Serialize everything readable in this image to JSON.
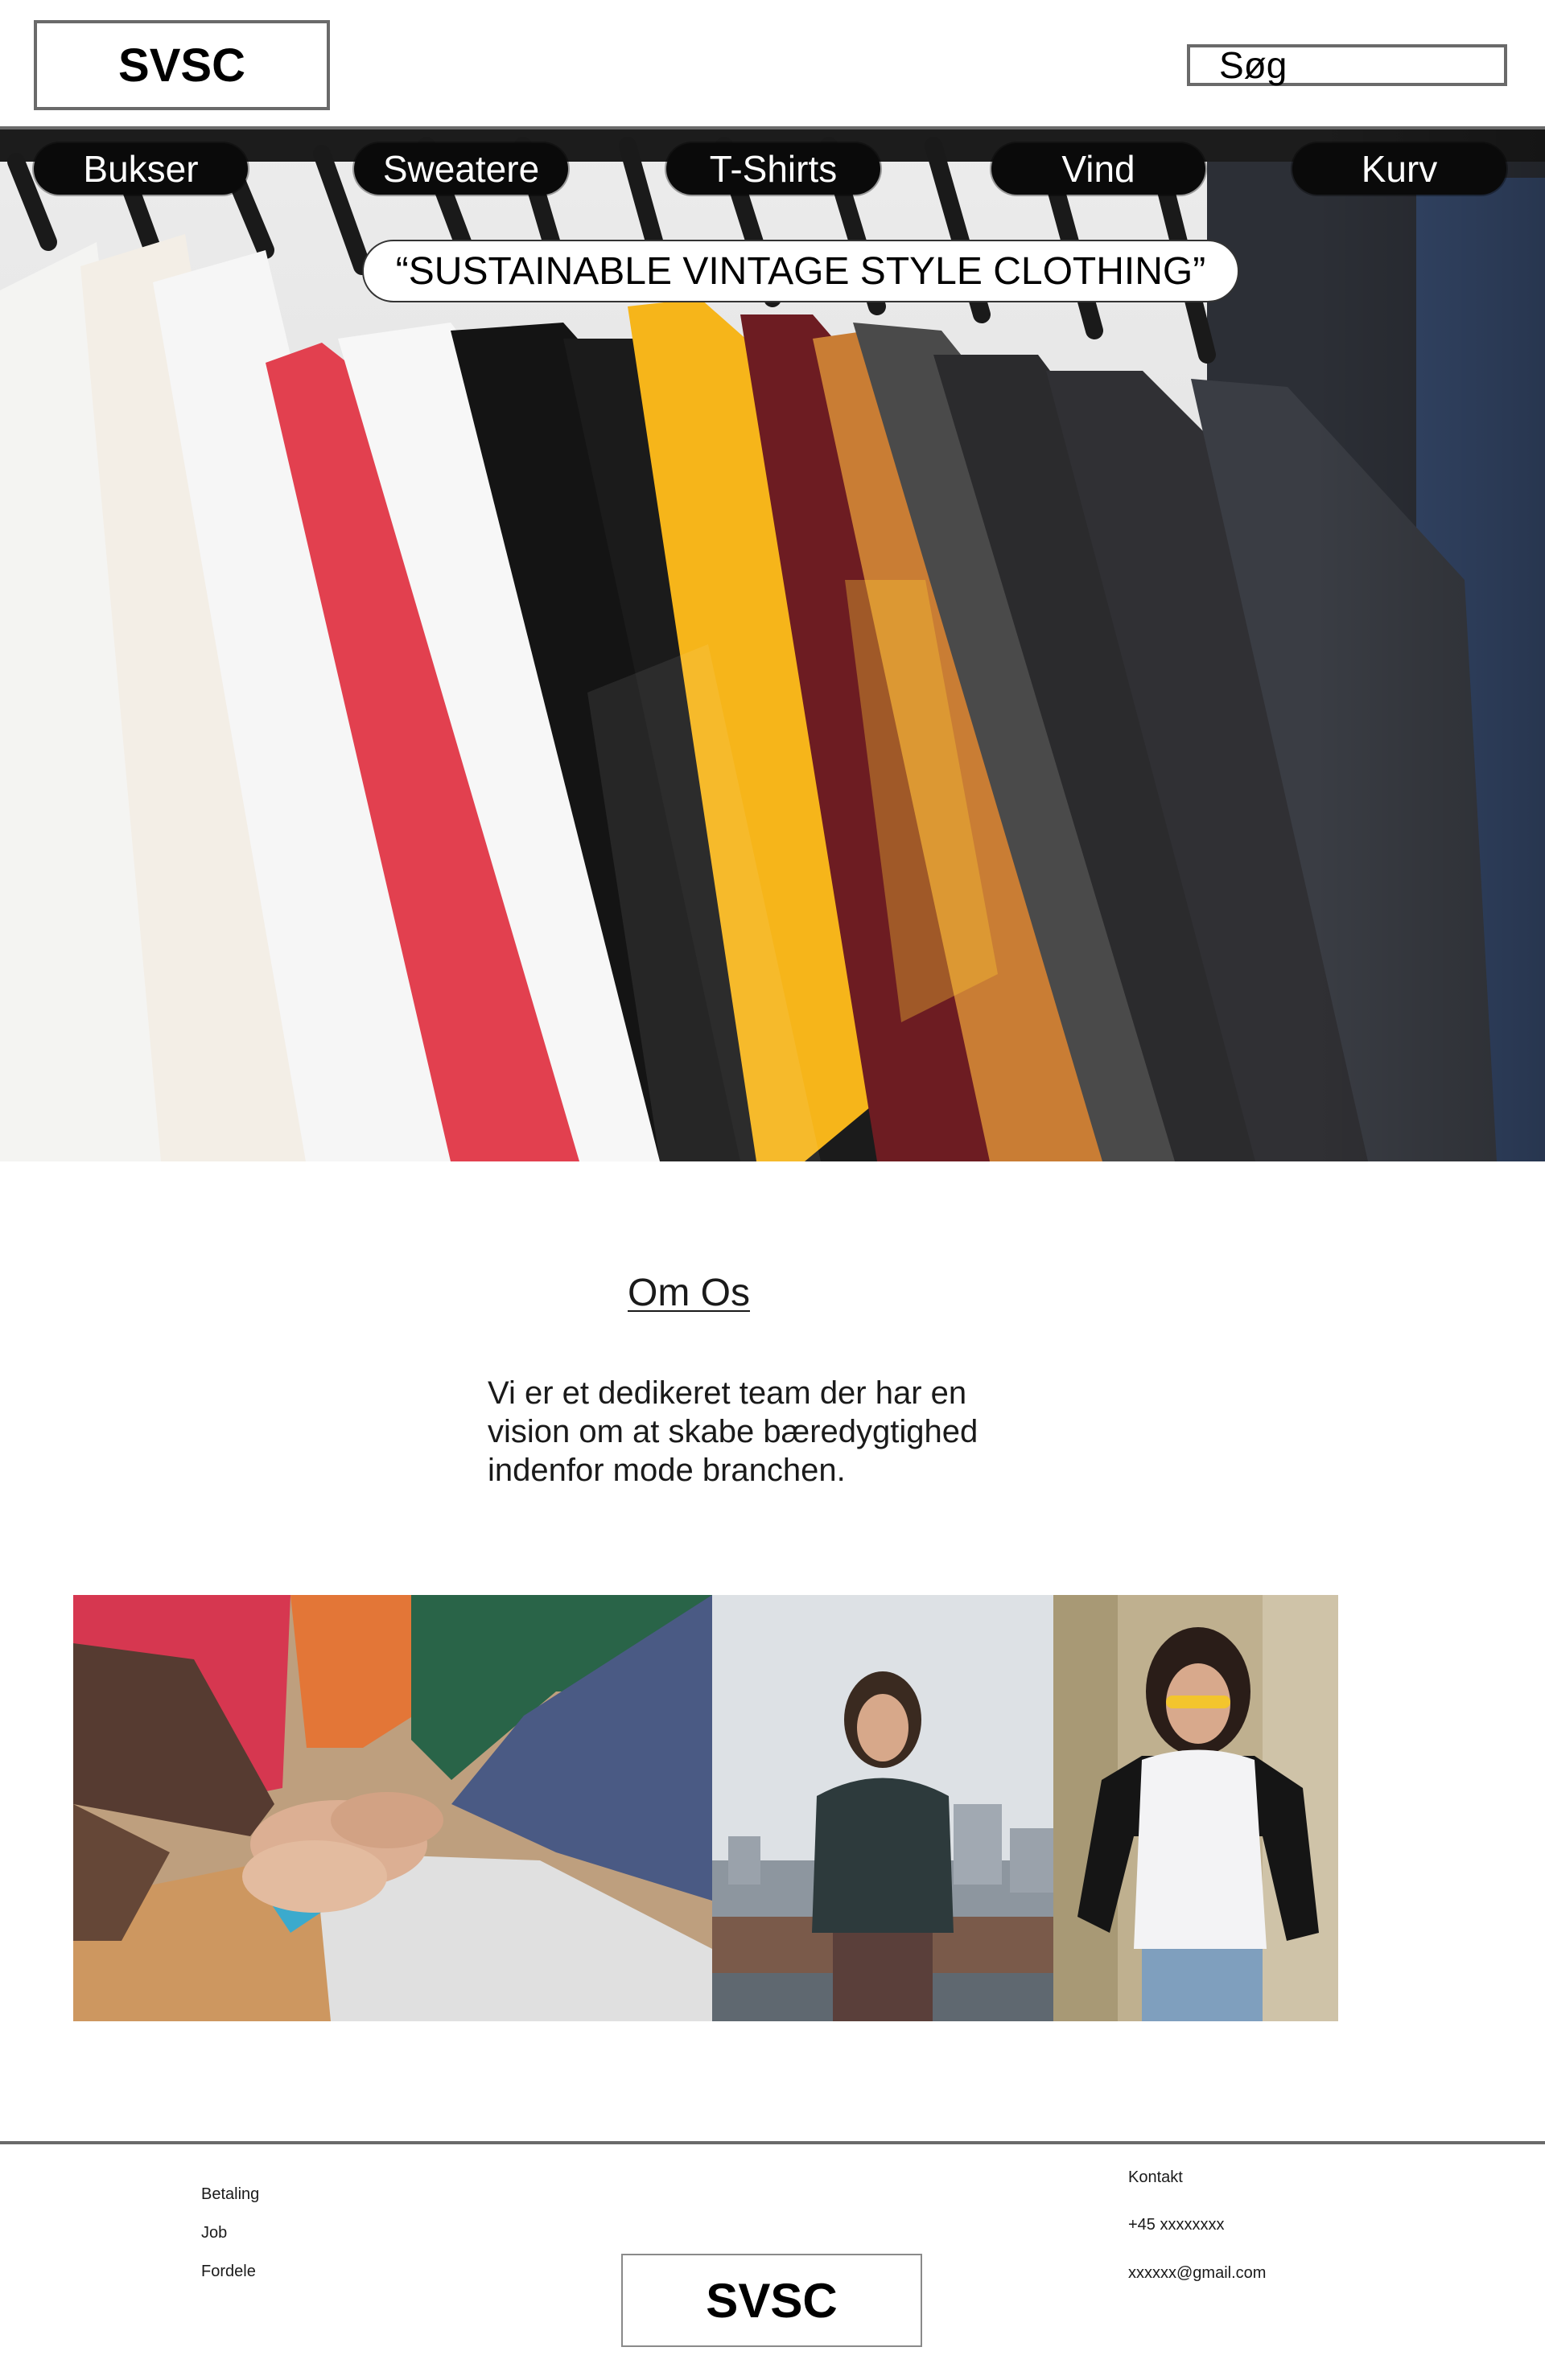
{
  "header": {
    "logo": "SVSC",
    "search_label": "Søg"
  },
  "nav": {
    "items": [
      {
        "label": "Bukser"
      },
      {
        "label": "Sweatere"
      },
      {
        "label": "T-Shirts"
      },
      {
        "label": "Vind"
      },
      {
        "label": "Kurv"
      }
    ]
  },
  "hero": {
    "tagline": "“SUSTAINABLE VINTAGE STYLE CLOTHING”",
    "image_subject": "t-shirts-on-rack-photo",
    "shirt_colors": [
      "#f4f4f2",
      "#f3eee6",
      "#f6f6f6",
      "#e2404f",
      "#f7f7f7",
      "#141414",
      "#1b1b1b",
      "#f6b51a",
      "#6d1c22",
      "#c97d34",
      "#4a4a4a",
      "#2b2b2d",
      "#303034",
      "#3a3d44"
    ]
  },
  "about": {
    "title": "Om Os",
    "body": "Vi er et dedikeret team der har en vision om at skabe bæredygtighed indenfor mode branchen."
  },
  "photos": [
    {
      "subject": "team-hands-photo"
    },
    {
      "subject": "man-in-sweater-photo"
    },
    {
      "subject": "woman-in-tshirt-photo"
    }
  ],
  "footer": {
    "links": [
      "Betaling",
      "Job",
      "Fordele"
    ],
    "contact_title": "Kontakt",
    "phone": "+45 xxxxxxxx",
    "email": "xxxxxx@gmail.com",
    "logo": "SVSC"
  }
}
